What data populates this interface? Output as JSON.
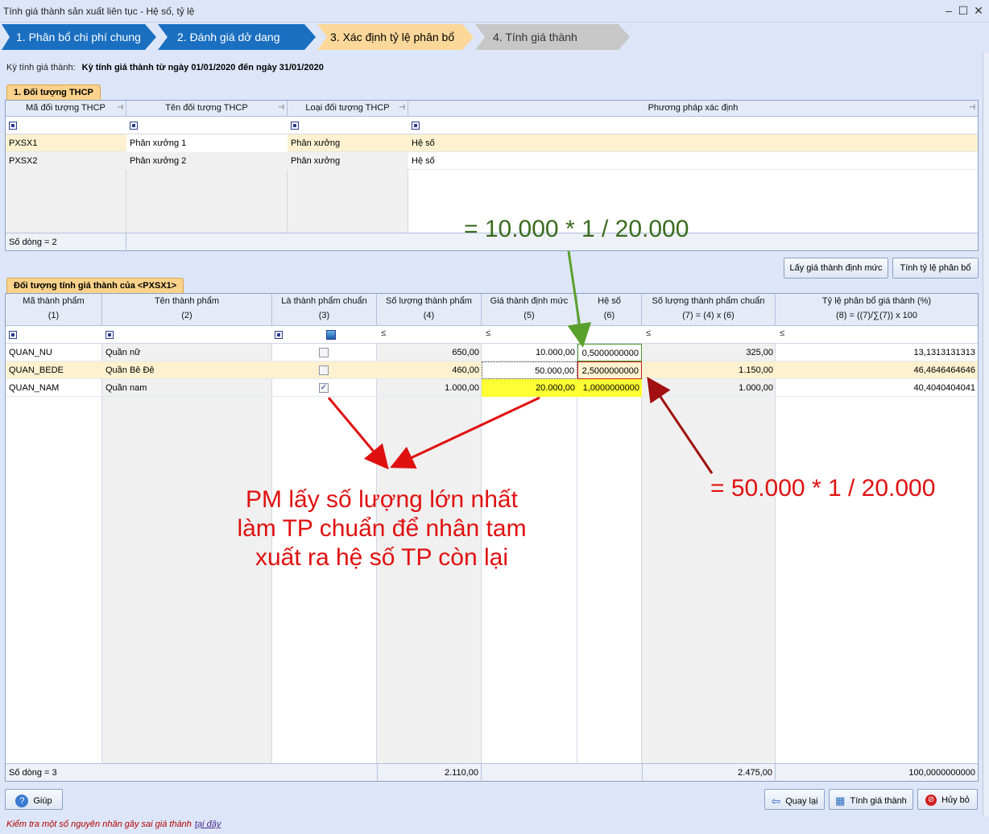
{
  "window": {
    "title": "Tính giá thành sản xuất liên tục - Hệ số, tỷ lệ"
  },
  "steps": [
    {
      "label": "1. Phân bổ chi phí chung",
      "state": "done"
    },
    {
      "label": "2. Đánh giá dở dang",
      "state": "done"
    },
    {
      "label": "3. Xác định tỷ lệ phân bổ",
      "state": "active"
    },
    {
      "label": "4. Tính giá thành",
      "state": "pending"
    }
  ],
  "period": {
    "label": "Kỳ tính giá thành:",
    "value": "Kỳ tính giá thành từ ngày 01/01/2020 đến ngày 31/01/2020"
  },
  "thcp": {
    "tab_label": "1. Đối tượng THCP",
    "columns": [
      "Mã đối tượng THCP",
      "Tên đối tượng THCP",
      "Loại đối tượng THCP",
      "Phương pháp xác định"
    ],
    "rows": [
      [
        "PXSX1",
        "Phân xưởng 1",
        "Phân xưởng",
        "Hệ số"
      ],
      [
        "PXSX2",
        "Phân xưởng 2",
        "Phân xưởng",
        "Hệ số"
      ]
    ],
    "footer": "Số dòng = 2"
  },
  "buttons": {
    "get_standard_cost": "Lấy giá thành định mức",
    "calc_ratio": "Tính tỷ lệ phân bổ",
    "help": "Giúp",
    "back": "Quay lại",
    "calc_cost": "Tính giá thành",
    "cancel": "Hủy bỏ"
  },
  "products": {
    "tab_label": "Đối tượng tính giá thành của <PXSX1>",
    "columns": [
      "Mã thành phẩm",
      "Tên thành phẩm",
      "Là thành phẩm chuẩn",
      "Số lượng thành phẩm",
      "Giá thành định mức",
      "Hệ số",
      "Số lượng thành phẩm chuẩn",
      "Tỷ lệ phân bổ giá thành (%)"
    ],
    "subheaders": [
      "(1)",
      "(2)",
      "(3)",
      "(4)",
      "(5)",
      "(6)",
      "(7) = (4) x (6)",
      "(8) = ((7)/∑(7)) x 100"
    ],
    "filter_le": "≤",
    "rows": [
      {
        "code": "QUAN_NU",
        "name": "Quần nữ",
        "is_standard": false,
        "qty": "650,00",
        "std_cost": "10.000,00",
        "coef": "0,5000000000",
        "std_qty": "325,00",
        "ratio": "13,1313131313"
      },
      {
        "code": "QUAN_BEDE",
        "name": "Quần Bê Đê",
        "is_standard": false,
        "qty": "460,00",
        "std_cost": "50.000,00",
        "coef": "2,5000000000",
        "std_qty": "1.150,00",
        "ratio": "46,4646464646"
      },
      {
        "code": "QUAN_NAM",
        "name": "Quần nam",
        "is_standard": true,
        "qty": "1.000,00",
        "std_cost": "20.000,00",
        "coef": "1,0000000000",
        "std_qty": "1.000,00",
        "ratio": "40,4040404041"
      }
    ],
    "footer": {
      "rows": "Số dòng = 3",
      "qty_total": "2.110,00",
      "std_qty_total": "2.475,00",
      "ratio_total": "100,0000000000"
    }
  },
  "annotations": {
    "green_formula": "= 10.000 * 1 / 20.000",
    "red_formula": "= 50.000 * 1 / 20.000",
    "note_lines": [
      "PM lấy số lượng lớn nhất",
      "làm TP chuẩn để nhân tam",
      "xuất ra hệ số TP còn lại"
    ]
  },
  "status": {
    "text": "Kiểm tra một số nguyên nhân gây sai giá thành",
    "link": "tại đây"
  },
  "colors": {
    "step_done": "#1a6fc1",
    "step_active": "#fbd89a",
    "step_pending": "#c7c7c7",
    "highlight_row": "#fdf1d0",
    "yellow_cell": "#ffff33",
    "annot_green": "#3a6b1f",
    "annot_red": "#e01010"
  }
}
